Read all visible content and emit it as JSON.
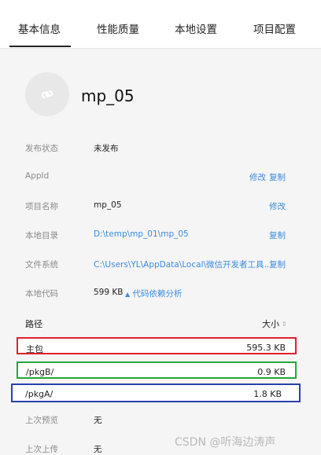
{
  "tabs": [
    {
      "label": "基本信息",
      "active": true
    },
    {
      "label": "性能质量",
      "active": false
    },
    {
      "label": "本地设置",
      "active": false
    },
    {
      "label": "项目配置",
      "active": false
    }
  ],
  "app": {
    "name": "mp_05",
    "avatar_icon": "mini-program-logo-icon"
  },
  "info": {
    "publish_status": {
      "label": "发布状态",
      "value": "未发布"
    },
    "appid": {
      "label": "AppId",
      "value": "",
      "actions": [
        "修改",
        "复制"
      ]
    },
    "project_name": {
      "label": "项目名称",
      "value": "mp_05",
      "action": "修改"
    },
    "local_dir": {
      "label": "本地目录",
      "value": "D:\\temp\\mp_01\\mp_05",
      "action": "复制"
    },
    "file_system": {
      "label": "文件系统",
      "value": "C:\\Users\\YL\\AppData\\Local\\微信开发者工具...",
      "action": "复制"
    },
    "local_code": {
      "label": "本地代码",
      "value": "599 KB",
      "link": "代码依赖分析"
    },
    "last_preview": {
      "label": "上次预览",
      "value": "无"
    },
    "last_upload": {
      "label": "上次上传",
      "value": "无"
    }
  },
  "packages": {
    "header_path": "路径",
    "header_size": "大小",
    "rows": [
      {
        "name": "主包",
        "size": "595.3 KB",
        "highlight": "#e0202a"
      },
      {
        "name": "/pkgB/",
        "size": "0.9 KB",
        "highlight": "#22a83a"
      },
      {
        "name": "/pkgA/",
        "size": "1.8 KB",
        "highlight": "#2a3fae"
      }
    ]
  },
  "watermark": "CSDN @听海边涛声",
  "colors": {
    "link": "#3b8be0",
    "background": "#f5f5f5"
  }
}
